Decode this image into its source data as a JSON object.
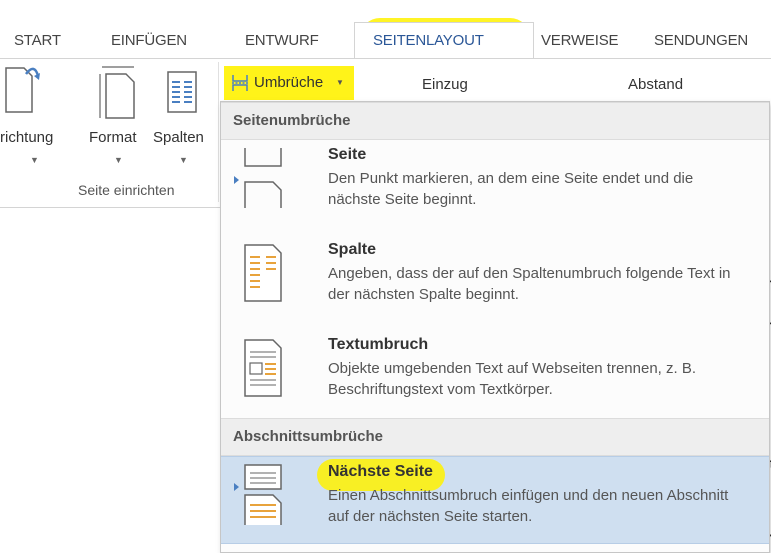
{
  "tabs": {
    "start": "START",
    "einfuegen": "EINFÜGEN",
    "entwurf": "ENTWURF",
    "seitenlayout": "SEITENLAYOUT",
    "verweise": "VERWEISE",
    "sendungen": "SENDUNGEN"
  },
  "ribbon": {
    "ausrichtung_label": "richtung",
    "format_label": "Format",
    "spalten_label": "Spalten",
    "group_label": "Seite einrichten",
    "umbrueche_label": "Umbrüche",
    "einzug_label": "Einzug",
    "abstand_label": "Abstand"
  },
  "menu": {
    "section1": "Seitenumbrüche",
    "section2": "Abschnittsumbrüche",
    "items": [
      {
        "title": "Seite",
        "desc": "Den Punkt markieren, an dem eine Seite endet und die nächste Seite beginnt.",
        "icon": "page-break-icon"
      },
      {
        "title": "Spalte",
        "desc": "Angeben, dass der auf den Spaltenumbruch folgende Text in der nächsten Spalte beginnt.",
        "icon": "column-break-icon"
      },
      {
        "title": "Textumbruch",
        "desc": "Objekte umgebenden Text auf Webseiten trennen, z. B. Beschriftungstext vom Textkörper.",
        "icon": "text-wrap-icon"
      },
      {
        "title": "Nächste Seite",
        "desc": "Einen Abschnittsumbruch einfügen und den neuen Abschnitt auf der nächsten Seite starten.",
        "icon": "next-page-icon"
      }
    ]
  },
  "document_edge": [
    "i",
    "n",
    "n",
    "it",
    "r"
  ],
  "colors": {
    "highlight": "#fff200",
    "selection": "#cfdff0",
    "accent": "#4a7fc1"
  }
}
